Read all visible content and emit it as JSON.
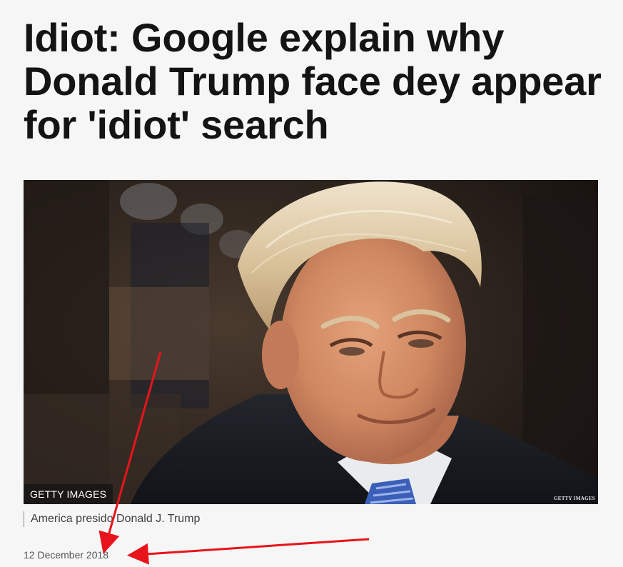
{
  "article": {
    "headline": "Idiot: Google explain why Donald Trump face dey appear for 'idiot' search",
    "image": {
      "credit": "GETTY IMAGES",
      "watermark": "GETTY IMAGES",
      "caption": "America presido Donald J. Trump"
    },
    "date": "12 December 2018"
  },
  "annotations": {
    "arrow_color": "#e8141b",
    "count": 2
  }
}
